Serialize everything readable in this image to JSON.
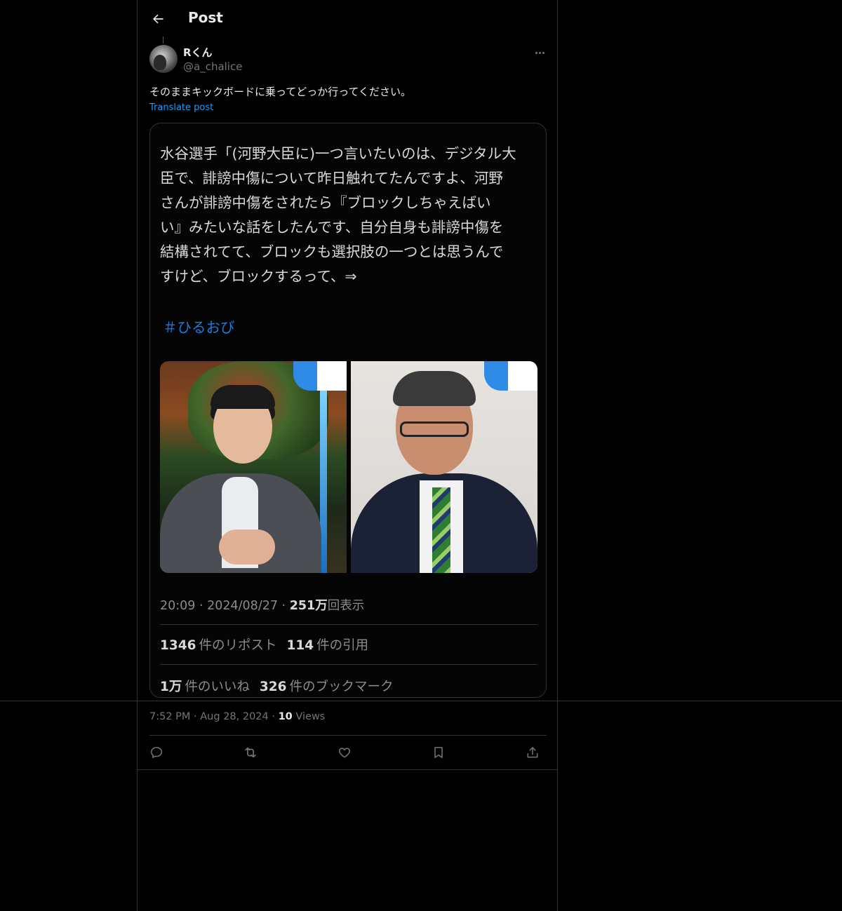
{
  "header": {
    "title": "Post"
  },
  "author": {
    "name": "Rくん",
    "handle": "@a_chalice"
  },
  "post": {
    "text": "そのままキックボードに乗ってどっか行ってください。",
    "translate_label": "Translate post",
    "time": "7:52 PM",
    "date": "Aug 28, 2024",
    "views_count": "10",
    "views_label": "Views"
  },
  "embedded": {
    "text": "水谷選手「(河野大臣に)一つ言いたいのは、デジタル大\n臣で、誹謗中傷について昨日触れてたんですよ、河野\nさんが誹謗中傷をされたら『ブロックしちゃえばい\nい』みたいな話をしたんです、自分自身も誹謗中傷を\n結構されてて、ブロックも選択肢の一つとは思うんで\nすけど、ブロックするって、⇒",
    "hashtag": "＃ひるおび",
    "meta_time": "20:09 · 2024/08/27 · ",
    "meta_views": "251万",
    "meta_views_label": "回表示",
    "reposts_count": "1346",
    "reposts_label": "件のリポスト",
    "quotes_count": "114",
    "quotes_label": "件の引用",
    "likes_count": "1万",
    "likes_label": "件のいいね",
    "bookmarks_count": "326",
    "bookmarks_label": "件のブックマーク"
  },
  "colors": {
    "accent": "#1d9bf0",
    "background": "#000000",
    "border": "#2f3336",
    "muted": "#71767b"
  },
  "icons": [
    "back-arrow-icon",
    "more-icon",
    "reply-icon",
    "repost-icon",
    "like-icon",
    "bookmark-icon",
    "share-icon"
  ]
}
